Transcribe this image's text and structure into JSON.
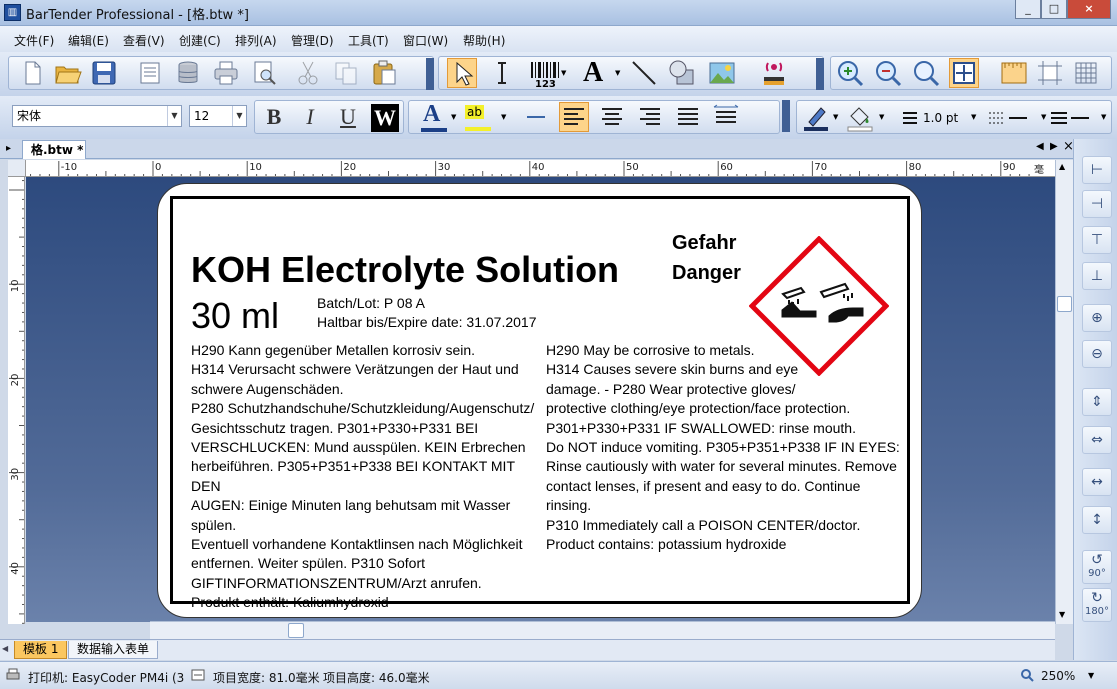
{
  "window": {
    "title": "BarTender Professional - [格.btw *]",
    "app_icon": "barcode-app-icon",
    "controls": [
      "_",
      "□",
      "×"
    ]
  },
  "menu": [
    "文件(F)",
    "编辑(E)",
    "查看(V)",
    "创建(C)",
    "排列(A)",
    "管理(D)",
    "工具(T)",
    "窗口(W)",
    "帮助(H)"
  ],
  "toolbar": {
    "font_name": "宋体",
    "font_size": "12",
    "line_width": "1.0 pt",
    "bold": "B",
    "italic": "I",
    "underline": "U",
    "reverse": "W",
    "text_tool": "A",
    "barcode_caption": "123",
    "text_color_letter": "A",
    "highlight_caption": "ab"
  },
  "doc_tab": "格.btw *",
  "ruler": {
    "unit": "毫米",
    "h_ticks": [
      "-10",
      "0",
      "10",
      "20",
      "30",
      "40",
      "50",
      "60",
      "70",
      "80",
      "90"
    ],
    "v_ticks": [
      "10",
      "20",
      "30",
      "40"
    ]
  },
  "label": {
    "product": "KOH Electrolyte Solution",
    "volume": "30 ml",
    "batch": "Batch/Lot: P 08 A",
    "expiry": "Haltbar bis/Expire date: 31.07.2017",
    "signal_de": "Gefahr",
    "signal_en": "Danger",
    "de_lines": [
      "H290 Kann gegenüber Metallen korrosiv sein.",
      "H314 Verursacht schwere Verätzungen der Haut und",
      "schwere Augenschäden.",
      "P280 Schutzhandschuhe/Schutzkleidung/Augenschutz/",
      "Gesichtsschutz tragen. P301+P330+P331 BEI",
      "VERSCHLUCKEN: Mund ausspülen. KEIN Erbrechen",
      "herbeiführen. P305+P351+P338 BEI KONTAKT MIT DEN",
      "AUGEN: Einige Minuten lang behutsam mit Wasser spülen.",
      "Eventuell vorhandene Kontaktlinsen nach Möglichkeit",
      "entfernen. Weiter spülen. P310 Sofort",
      "GIFTINFORMATIONSZENTRUM/Arzt anrufen.",
      "Produkt enthält: Kaliumhydroxid"
    ],
    "en_lines": [
      "H290 May be corrosive to metals.",
      "H314 Causes severe skin burns and eye",
      "damage. - P280 Wear protective gloves/",
      "protective clothing/eye protection/face protection.",
      "P301+P330+P331 IF SWALLOWED: rinse mouth.",
      "Do NOT induce vomiting. P305+P351+P338 IF IN EYES:",
      "Rinse cautiously with water for several minutes. Remove",
      "contact lenses, if present and easy to do. Continue rinsing.",
      "P310 Immediately call a POISON CENTER/doctor.",
      "Product contains: potassium hydroxide"
    ]
  },
  "sheet_tabs": [
    "模板 1",
    "数据输入表单"
  ],
  "right_panel": {
    "rotate_90": "90°",
    "rotate_180": "180°"
  },
  "status": {
    "printer": "打印机: EasyCoder PM4i (3(",
    "width": "项目宽度: 81.0毫米",
    "height": "项目高度: 46.0毫米",
    "zoom": "250%"
  },
  "colors": {
    "pictogram_red": "#e30613",
    "selected_tool": "#fdd48a"
  }
}
